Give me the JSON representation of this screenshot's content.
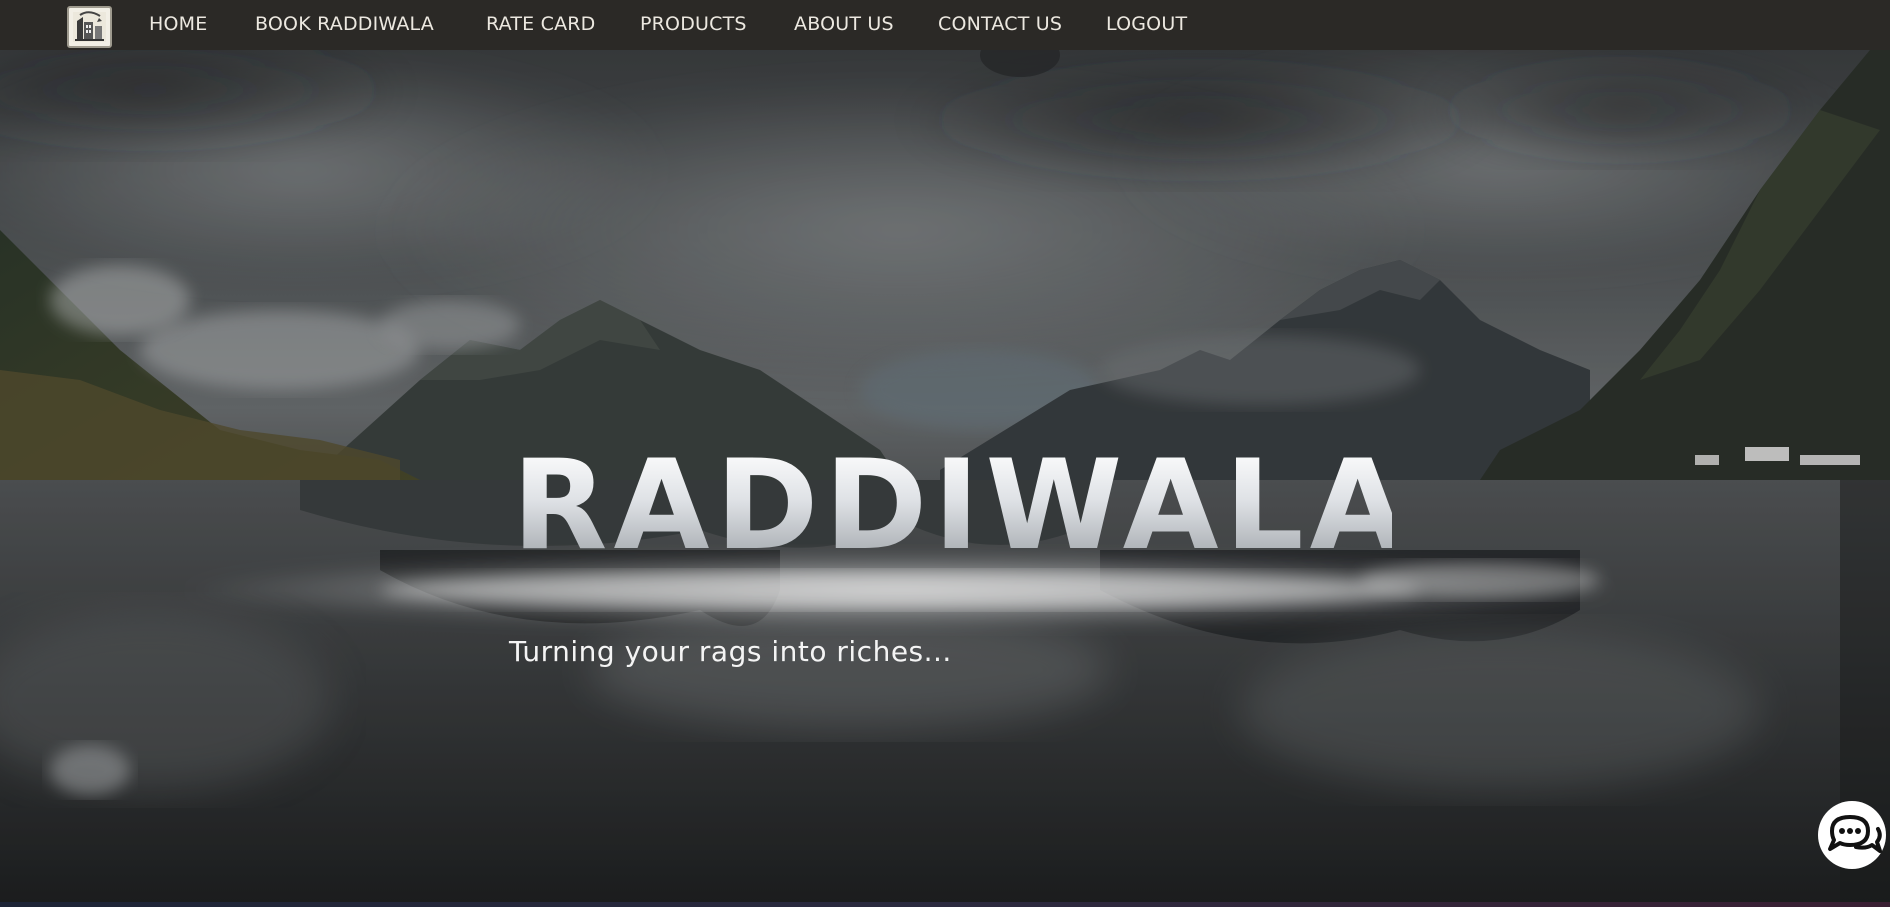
{
  "nav": {
    "logo_icon": "raddiwala-logo-icon",
    "links": [
      {
        "label": "HOME"
      },
      {
        "label": "BOOK RADDIWALA"
      },
      {
        "label": "RATE CARD"
      },
      {
        "label": "PRODUCTS"
      },
      {
        "label": "ABOUT US"
      },
      {
        "label": "CONTACT US"
      },
      {
        "label": "LOGOUT"
      }
    ]
  },
  "hero": {
    "title": "RADDIWALA",
    "tagline": "Turning your rags into riches...",
    "background": "misty-mountain-lake-image"
  },
  "chat": {
    "icon": "chat-bubbles-icon"
  },
  "colors": {
    "nav_bg": "#2b2926",
    "nav_text": "#ece8e0",
    "title_text": "#e7e9ec"
  }
}
